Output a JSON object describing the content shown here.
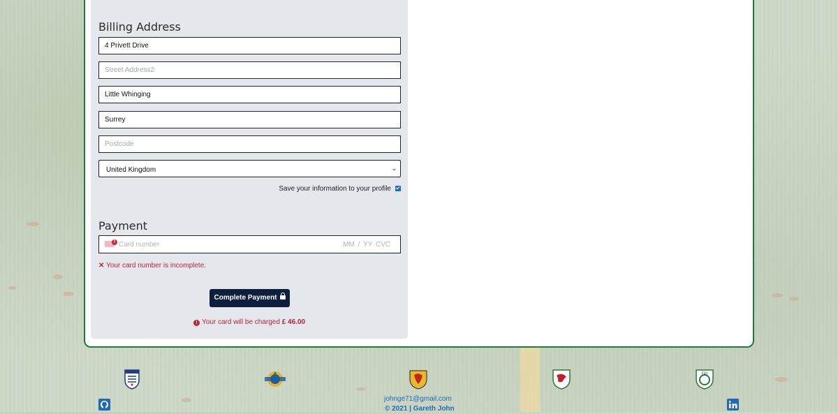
{
  "billing": {
    "title": "Billing Address",
    "street1_value": "4 Privett Drive",
    "street2_placeholder": "Street Address2",
    "town_value": "Little Whinging",
    "county_value": "Surrey",
    "postcode_placeholder": "Postcode",
    "country_selected": "United Kingdom",
    "save_label": "Save your information to your profile",
    "save_checked": true
  },
  "payment": {
    "title": "Payment",
    "card_placeholder": "Card number",
    "card_expiry_cvc_placeholder": "MM / YY  CVC",
    "error_icon": "x-icon",
    "error_text": "Your card number is incomplete.",
    "submit_label": "Complete Payment",
    "charge_text": "Your card will be charged",
    "charge_amount": "£ 46.00"
  },
  "footer": {
    "crests": [
      {
        "name": "england-crest",
        "primary": "#1d3f86",
        "secondary": "#d21f2e"
      },
      {
        "name": "northern-ireland-crest",
        "primary": "#1f5d9c",
        "secondary": "#e0b23a"
      },
      {
        "name": "scotland-crest",
        "primary": "#e7b92b",
        "secondary": "#c0281c"
      },
      {
        "name": "wales-crest",
        "primary": "#c41e2a",
        "secondary": "#2f7a35"
      },
      {
        "name": "ireland-crest",
        "primary": "#2b7a3a",
        "secondary": "#ffffff"
      }
    ],
    "email": "johnge71@gmail.com",
    "copyright": "© 2021 | Gareth John"
  },
  "colors": {
    "accent_green": "#1f7a3a",
    "button_navy": "#0d1f3c",
    "error_red": "#c0243b",
    "link_blue": "#1f6ab3"
  }
}
